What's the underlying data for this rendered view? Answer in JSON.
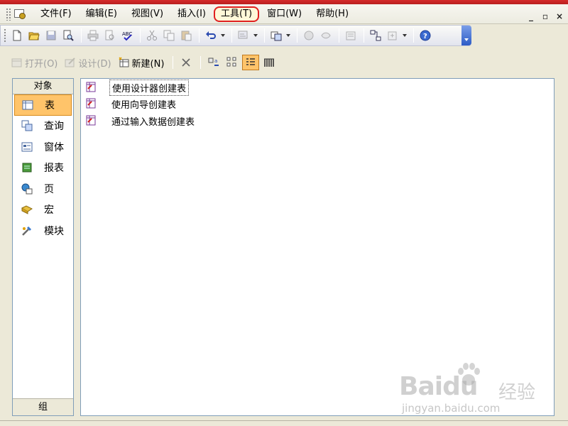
{
  "menubar": {
    "items": [
      {
        "label": "文件(F)"
      },
      {
        "label": "编辑(E)"
      },
      {
        "label": "视图(V)"
      },
      {
        "label": "插入(I)"
      },
      {
        "label": "工具(T)",
        "highlighted": true
      },
      {
        "label": "窗口(W)"
      },
      {
        "label": "帮助(H)"
      }
    ]
  },
  "window_controls": {
    "close": "×",
    "restore": "▫",
    "minimize": "_"
  },
  "toolbar": {
    "icons": [
      "new-icon",
      "open-icon",
      "save-icon",
      "search-file-icon",
      "print-icon",
      "print-preview-icon",
      "spelling-icon",
      "cut-icon",
      "copy-icon",
      "paste-icon",
      "undo-icon",
      "analyze-icon",
      "office-links-icon",
      "code-icon",
      "script-icon",
      "properties-icon",
      "relationships-icon",
      "new-object-icon",
      "help-icon"
    ]
  },
  "db_toolbar": {
    "open_label": "打开(O)",
    "design_label": "设计(D)",
    "new_label": "新建(N)"
  },
  "objects_bar": {
    "header": "对象",
    "items": [
      {
        "label": "表",
        "icon": "table-icon",
        "selected": true
      },
      {
        "label": "查询",
        "icon": "query-icon"
      },
      {
        "label": "窗体",
        "icon": "form-icon"
      },
      {
        "label": "报表",
        "icon": "report-icon"
      },
      {
        "label": "页",
        "icon": "page-icon"
      },
      {
        "label": "宏",
        "icon": "macro-icon"
      },
      {
        "label": "模块",
        "icon": "module-icon"
      }
    ],
    "footer": "组"
  },
  "list": {
    "items": [
      {
        "label": "使用设计器创建表"
      },
      {
        "label": "使用向导创建表"
      },
      {
        "label": "通过输入数据创建表"
      }
    ]
  },
  "watermark": {
    "logo": "Baidu",
    "cn": "经验",
    "url": "jingyan.baidu.com"
  },
  "colors": {
    "selected_bg": "#ffc46a",
    "highlight_ring": "#e02020",
    "panel_border": "#7f9db9",
    "toolbar_end": "#2c5bc6"
  }
}
